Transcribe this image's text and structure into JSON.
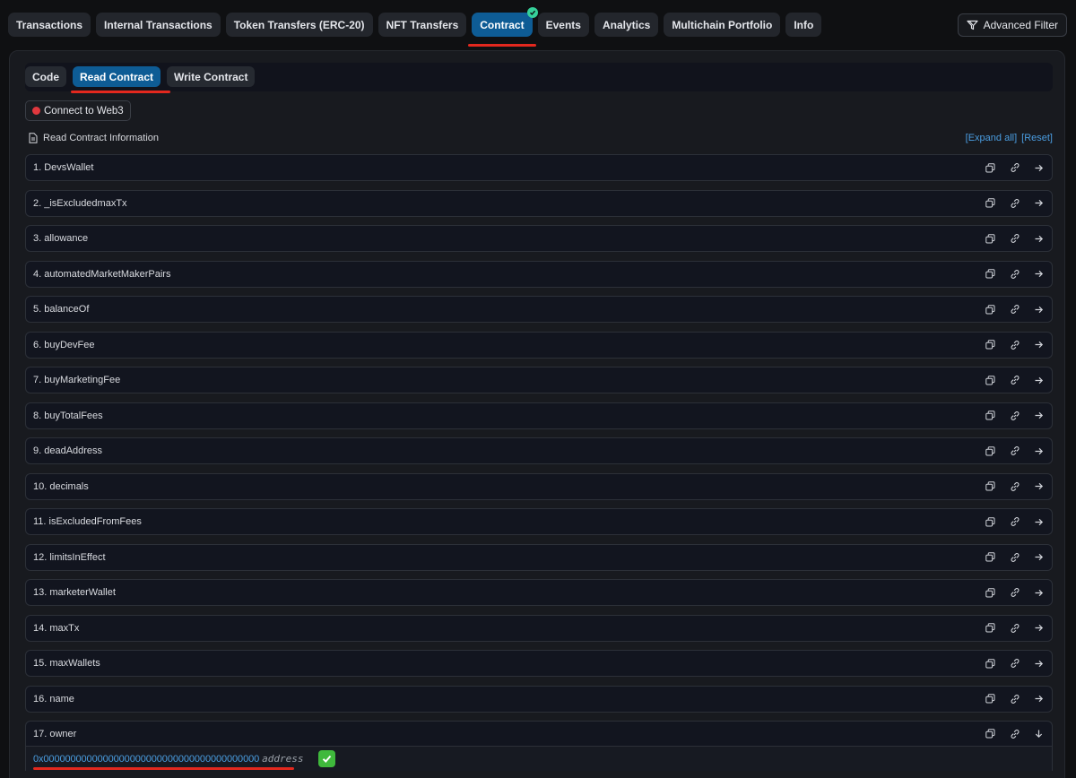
{
  "tabs": [
    {
      "label": "Transactions",
      "name": "tab-transactions",
      "active": false
    },
    {
      "label": "Internal Transactions",
      "name": "tab-internal-transactions",
      "active": false
    },
    {
      "label": "Token Transfers (ERC-20)",
      "name": "tab-token-transfers",
      "active": false
    },
    {
      "label": "NFT Transfers",
      "name": "tab-nft-transfers",
      "active": false
    },
    {
      "label": "Contract",
      "name": "tab-contract",
      "active": true,
      "verified": true
    },
    {
      "label": "Events",
      "name": "tab-events",
      "active": false
    },
    {
      "label": "Analytics",
      "name": "tab-analytics",
      "active": false
    },
    {
      "label": "Multichain Portfolio",
      "name": "tab-multichain-portfolio",
      "active": false
    },
    {
      "label": "Info",
      "name": "tab-info",
      "active": false
    }
  ],
  "advanced_filter": {
    "label": "Advanced Filter",
    "icon": "filter-icon"
  },
  "subtabs": [
    {
      "label": "Code",
      "name": "subtab-code",
      "active": false
    },
    {
      "label": "Read Contract",
      "name": "subtab-read-contract",
      "active": true
    },
    {
      "label": "Write Contract",
      "name": "subtab-write-contract",
      "active": false
    }
  ],
  "connect": {
    "label": "Connect to Web3",
    "status_color": "#e0383e"
  },
  "info": {
    "title": "Read Contract Information",
    "expand_all": "[Expand all]",
    "reset": "[Reset]"
  },
  "functions": [
    {
      "label": "1. DevsWallet"
    },
    {
      "label": "2. _isExcludedmaxTx"
    },
    {
      "label": "3. allowance"
    },
    {
      "label": "4. automatedMarketMakerPairs"
    },
    {
      "label": "5. balanceOf"
    },
    {
      "label": "6. buyDevFee"
    },
    {
      "label": "7. buyMarketingFee"
    },
    {
      "label": "8. buyTotalFees"
    },
    {
      "label": "9. deadAddress"
    },
    {
      "label": "10. decimals"
    },
    {
      "label": "11. isExcludedFromFees"
    },
    {
      "label": "12. limitsInEffect"
    },
    {
      "label": "13. marketerWallet"
    },
    {
      "label": "14. maxTx"
    },
    {
      "label": "15. maxWallets"
    },
    {
      "label": "16. name"
    }
  ],
  "expanded_function": {
    "label": "17. owner",
    "result_value": "0x0000000000000000000000000000000000000000",
    "result_type": "address"
  },
  "colors": {
    "accent": "#0e5c95",
    "highlight": "#e3281e",
    "link": "#4a9de0",
    "verified": "#35d09a",
    "check": "#3fb93c"
  }
}
